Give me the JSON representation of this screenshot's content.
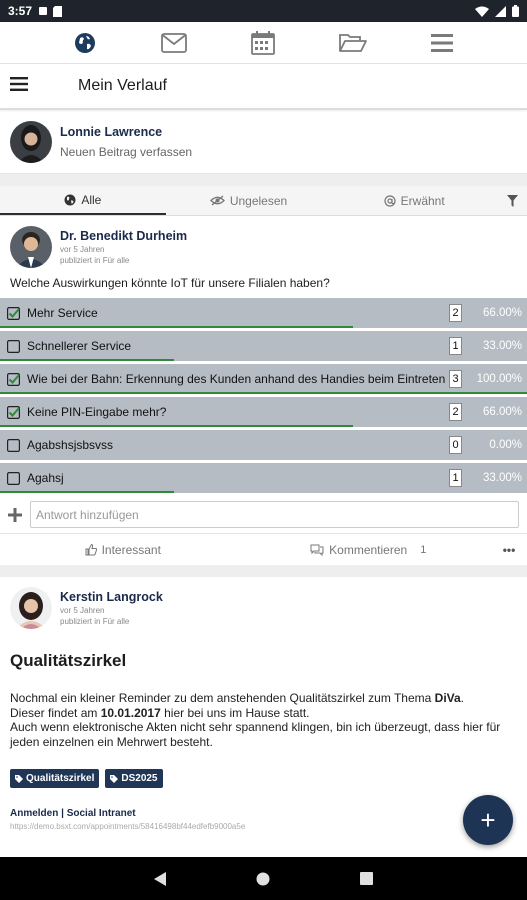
{
  "status": {
    "time": "3:57"
  },
  "app": {
    "page_title": "Mein Verlauf"
  },
  "composer": {
    "user_name": "Lonnie Lawrence",
    "prompt": "Neuen Beitrag verfassen"
  },
  "filters": {
    "all": "Alle",
    "unread": "Ungelesen",
    "mentioned": "Erwähnt"
  },
  "post1": {
    "author": "Dr. Benedikt Durheim",
    "time": "vor 5 Jahren",
    "location": "publiziert in Für alle",
    "question": "Welche Auswirkungen könnte IoT für unsere Filialen haben?",
    "options": [
      {
        "label": "Mehr Service",
        "checked": true,
        "count": "2",
        "pct": "66.00%",
        "progress": 0.67
      },
      {
        "label": "Schnellerer Service",
        "checked": false,
        "count": "1",
        "pct": "33.00%",
        "progress": 0.33
      },
      {
        "label": "Wie bei der Bahn: Erkennung des Kunden anhand des Handies beim Eintreten",
        "checked": true,
        "count": "3",
        "pct": "100.00%",
        "progress": 1.0
      },
      {
        "label": "Keine PIN-Eingabe mehr?",
        "checked": true,
        "count": "2",
        "pct": "66.00%",
        "progress": 0.67
      },
      {
        "label": "Agabshsjsbsvss",
        "checked": false,
        "count": "0",
        "pct": "0.00%",
        "progress": 0.0
      },
      {
        "label": "Agahsj",
        "checked": false,
        "count": "1",
        "pct": "33.00%",
        "progress": 0.33
      }
    ],
    "answer_placeholder": "Antwort hinzufügen",
    "like_label": "Interessant",
    "comment_label": "Kommentieren",
    "comment_count": "1"
  },
  "post2": {
    "author": "Kerstin Langrock",
    "time": "vor 5 Jahren",
    "location": "publiziert in Für alle",
    "heading": "Qualitätszirkel",
    "line1_pre": "Nochmal ein kleiner Reminder zu dem anstehenden Qualitätszirkel zum Thema ",
    "line1_bold": "DiVa",
    "line1_post": ".",
    "line2_pre": "Dieser findet am ",
    "line2_bold": "10.01.2017",
    "line2_post": " hier bei uns im Hause statt.",
    "line3": "Auch wenn elektronische Akten nicht sehr spannend klingen, bin ich überzeugt, dass hier für jeden einzelnen ein Mehrwert besteht.",
    "tags": [
      "Qualitätszirkel",
      "DS2025"
    ],
    "ref_title": "Anmelden | Social Intranet",
    "ref_url": "https://demo.bsxt.com/appointments/58416498bf44edfefb9000a5e"
  },
  "fab_label": "+",
  "colors": {
    "navy": "#1e3454",
    "poll_bg": "#b5bcc4",
    "progress": "#2f8a3a"
  }
}
